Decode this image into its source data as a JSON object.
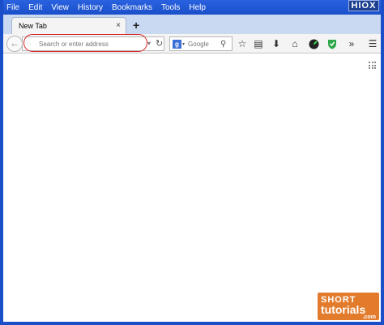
{
  "menubar": {
    "items": [
      {
        "label": "File"
      },
      {
        "label": "Edit"
      },
      {
        "label": "View"
      },
      {
        "label": "History"
      },
      {
        "label": "Bookmarks"
      },
      {
        "label": "Tools"
      },
      {
        "label": "Help"
      }
    ]
  },
  "window_controls": {
    "minimize": "_",
    "maximize": "□",
    "close": "×"
  },
  "watermark_top": "HIOX",
  "tabs": [
    {
      "label": "New Tab",
      "close": "×"
    }
  ],
  "newtab_symbol": "+",
  "navbar": {
    "back_symbol": "←",
    "url_placeholder": "Search or enter address",
    "reload_symbol": "C",
    "search_engine_letter": "g",
    "search_placeholder": "Google",
    "icons": [
      "star-icon",
      "clipboard-icon",
      "download-icon",
      "home-icon",
      "dial-icon",
      "shield-icon",
      "overflow-icon",
      "menu-icon"
    ]
  },
  "watermark_bottom": {
    "line1": "SHORT",
    "line2": "tutorials",
    "line3": ".com"
  },
  "colors": {
    "title_bar": "#1a4fc9",
    "highlight": "#d62222",
    "brand": "#e37b2c"
  }
}
